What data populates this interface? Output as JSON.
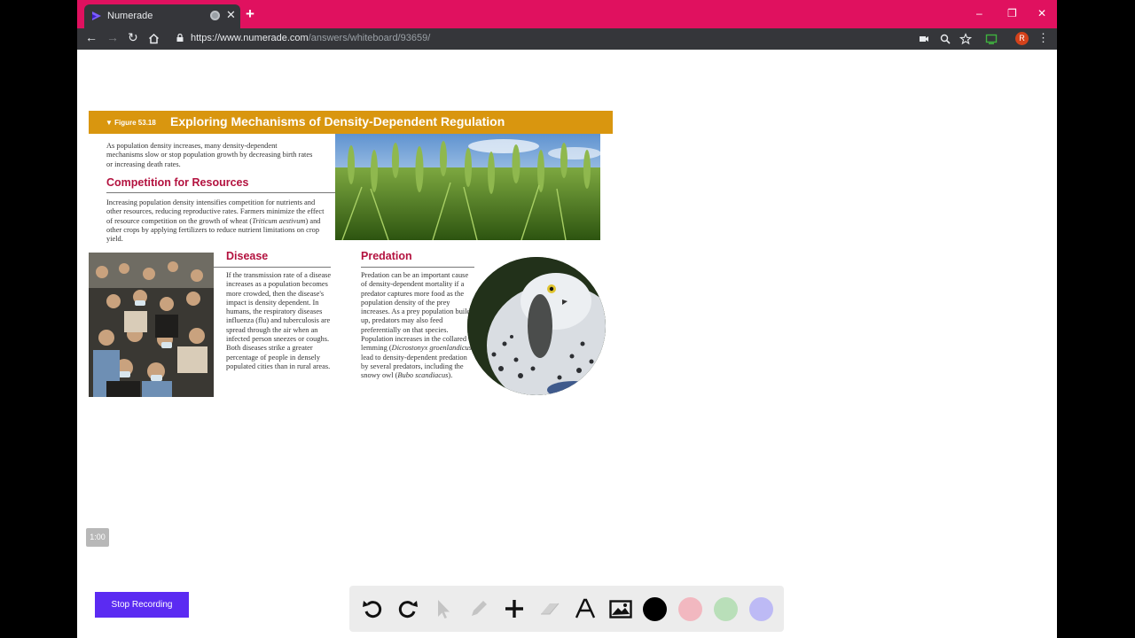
{
  "browser": {
    "tab_title": "Numerade",
    "url_host": "https://www.numerade.com",
    "url_path": "/answers/whiteboard/93659/",
    "avatar_initial": "R",
    "tab_color": "#e0115f"
  },
  "figure": {
    "label": "▼ Figure 53.18",
    "title": "Exploring Mechanisms of Density-Dependent Regulation",
    "intro": "As population density increases, many density-dependent mechanisms slow or stop population growth by decreasing birth rates or increasing death rates.",
    "competition": {
      "heading": "Competition for Resources",
      "text_before": "Increasing population density intensifies competition for nutrients and other resources, reducing reproductive rates. Farmers minimize the effect of resource competition on the growth of wheat (",
      "species": "Triticum aestivum",
      "text_after": ") and other crops by applying fertilizers to reduce nutrient limitations on crop yield."
    },
    "disease": {
      "heading": "Disease",
      "text": "If the transmission rate of a disease increases as a population becomes more crowded, then the disease's impact is density dependent. In humans, the respiratory diseases influenza (flu) and tuberculosis are spread through the air when an infected person sneezes or coughs. Both diseases strike a greater percentage of people in densely populated cities than in rural areas."
    },
    "predation": {
      "heading": "Predation",
      "text_before": "Predation can be an important cause of density-dependent mortality if a predator captures more food as the population density of the prey increases. As a prey population builds up, predators may also feed preferentially on that species. Population increases in the collared lemming (",
      "species1": "Dicrostonyx groenlandicus",
      "text_mid": ") lead to density-dependent predation by several predators, including the snowy owl (",
      "species2": "Bubo scandiacus",
      "text_after": ")."
    },
    "accent_color": "#d9960f",
    "heading_color": "#b3123f"
  },
  "recording": {
    "timer": "1:00",
    "stop_label": "Stop Recording",
    "button_color": "#5b2bf2"
  },
  "toolbar": {
    "tools": [
      "undo-icon",
      "redo-icon",
      "select-icon",
      "pen-icon",
      "add-icon",
      "eraser-icon",
      "text-icon",
      "image-icon"
    ],
    "colors": [
      "#000000",
      "#f2b8c0",
      "#b9dfb9",
      "#bdbaf5"
    ]
  }
}
